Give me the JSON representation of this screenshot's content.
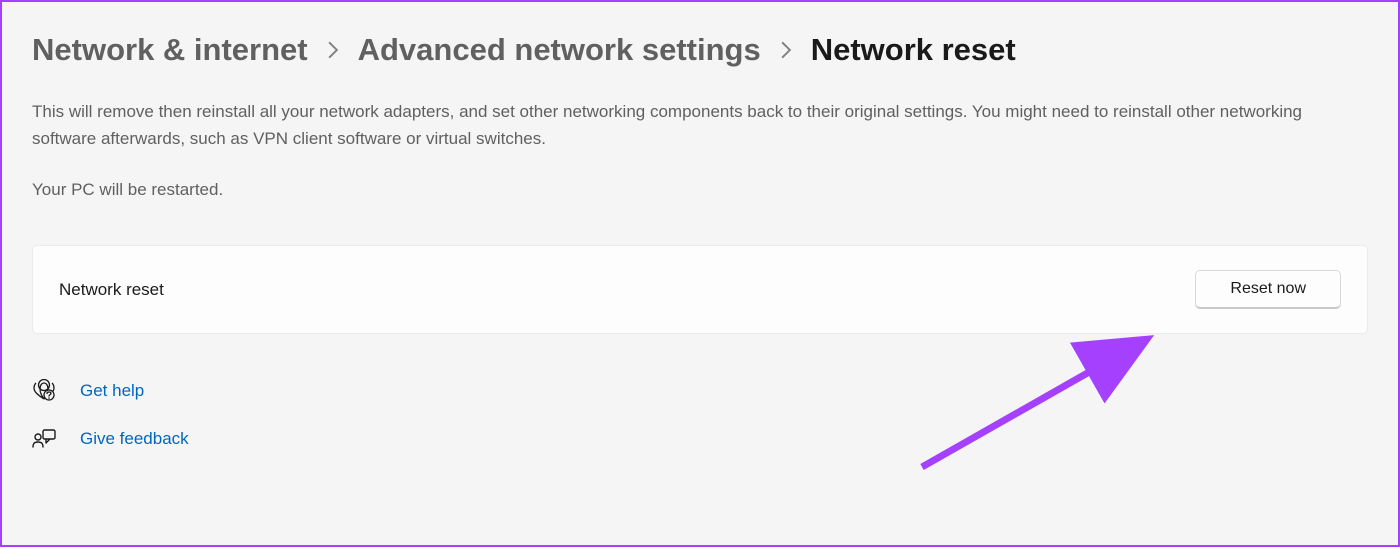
{
  "breadcrumb": {
    "items": [
      {
        "label": "Network & internet",
        "current": false
      },
      {
        "label": "Advanced network settings",
        "current": false
      },
      {
        "label": "Network reset",
        "current": true
      }
    ]
  },
  "description": "This will remove then reinstall all your network adapters, and set other networking components back to their original settings. You might need to reinstall other networking software afterwards, such as VPN client software or virtual switches.",
  "restart_note": "Your PC will be restarted.",
  "reset_card": {
    "label": "Network reset",
    "button_label": "Reset now"
  },
  "help_links": {
    "get_help": "Get help",
    "give_feedback": "Give feedback"
  },
  "colors": {
    "accent": "#0067c0",
    "annotation": "#a640ff"
  }
}
